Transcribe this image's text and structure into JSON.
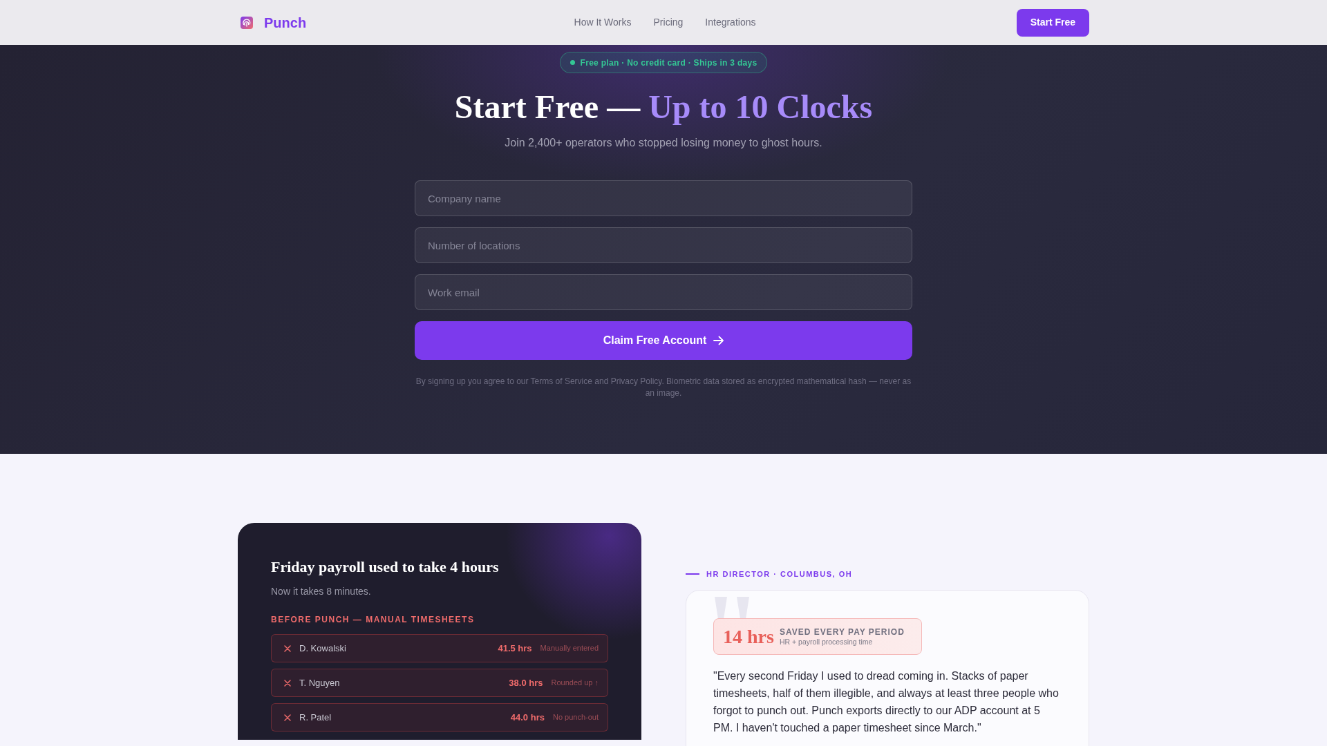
{
  "navbar": {
    "brand": "Punch",
    "links": [
      {
        "label": "How It Works"
      },
      {
        "label": "Pricing"
      },
      {
        "label": "Integrations"
      }
    ],
    "cta": "Start Free"
  },
  "hero": {
    "badge": "Free plan · No credit card · Ships in 3 days",
    "title": "Start Free — ",
    "title_highlight": "Up to 10 Clocks",
    "subtitle": "Join 2,400+ operators who stopped losing money to ghost hours.",
    "fields": [
      {
        "placeholder": "Company name"
      },
      {
        "placeholder": "Number of locations"
      },
      {
        "placeholder": "Work email"
      }
    ],
    "submit": "Claim Free Account",
    "legal": "By signing up you agree to our Terms of Service and Privacy Policy. Biometric data stored as encrypted mathematical hash — never as an image."
  },
  "before_card": {
    "title": "Friday payroll used to take 4 hours",
    "subtitle": "Now it takes 8 minutes.",
    "section_label": "BEFORE PUNCH — MANUAL TIMESHEETS",
    "rows": [
      {
        "name": "D. Kowalski",
        "hours": "41.5 hrs",
        "note": "Manually entered"
      },
      {
        "name": "T. Nguyen",
        "hours": "38.0 hrs",
        "note": "Rounded up ↑"
      },
      {
        "name": "R. Patel",
        "hours": "44.0 hrs",
        "note": "No punch-out"
      }
    ]
  },
  "testimonial": {
    "eyebrow": "HR DIRECTOR · COLUMBUS, OH",
    "stat": {
      "value": "14 hrs",
      "label": "SAVED EVERY PAY PERIOD",
      "caption": "HR + payroll processing time"
    },
    "quote": "\"Every second Friday I used to dread coming in. Stacks of paper timesheets, half of them illegible, and always at least three people who forgot to punch out. Punch exports directly to our ADP account at 5 PM. I haven't touched a paper timesheet since March.\""
  }
}
